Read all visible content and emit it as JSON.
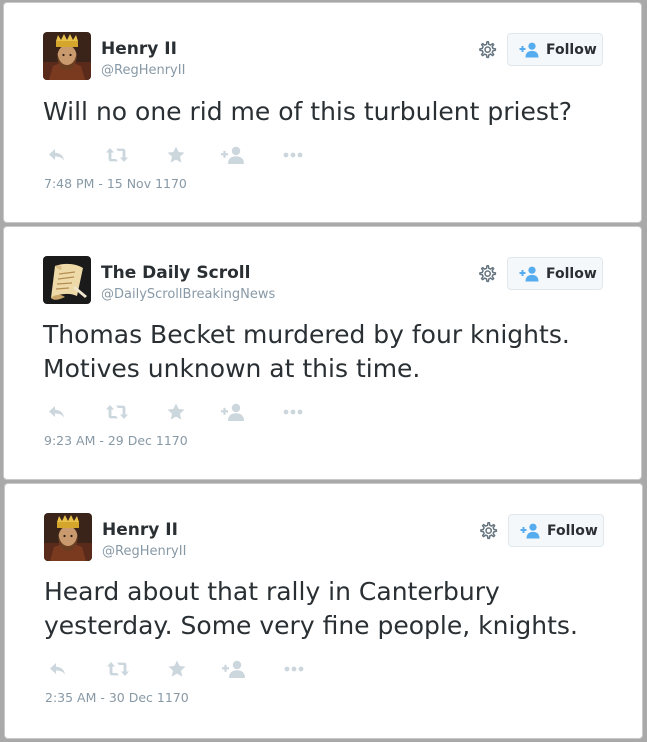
{
  "follow_label": "Follow",
  "accent_color": "#55acee",
  "tweets": [
    {
      "name": "Henry II",
      "handle": "@RegHenryII",
      "avatar": "king-portrait",
      "text": "Will no one rid me of this turbulent priest?",
      "timestamp": "7:48 PM - 15 Nov 1170"
    },
    {
      "name": "The Daily Scroll",
      "handle": "@DailyScrollBreakingNews",
      "avatar": "scroll-logo",
      "text": "Thomas Becket murdered by four knights.\nMotives unknown at this time.",
      "timestamp": "9:23 AM - 29 Dec 1170"
    },
    {
      "name": "Henry II",
      "handle": "@RegHenryII",
      "avatar": "king-portrait",
      "text": "Heard about that rally in Canterbury\nyesterday. Some very fine people, knights.",
      "timestamp": "2:35 AM - 30 Dec 1170"
    }
  ],
  "action_icons": [
    "reply-icon",
    "retweet-icon",
    "favorite-icon",
    "follow-user-icon",
    "more-icon"
  ]
}
